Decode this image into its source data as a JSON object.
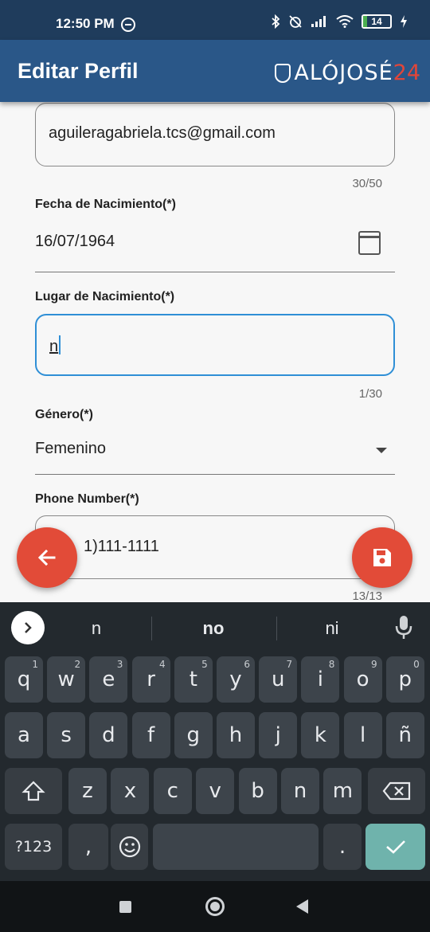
{
  "status_bar": {
    "time": "12:50 PM",
    "battery": "14",
    "icons": [
      "bluetooth-icon",
      "mute-alarm-icon",
      "signal-icon",
      "wifi-icon",
      "battery-icon",
      "charging-icon"
    ]
  },
  "app_bar": {
    "title": "Editar Perfil",
    "brand_name": "ALÓJOSÉ",
    "brand_number": "24"
  },
  "form": {
    "email": {
      "value": "aguileragabriela.tcs@gmail.com",
      "counter": "30/50"
    },
    "birth_date": {
      "label": "Fecha de Nacimiento(*)",
      "value": "16/07/1964"
    },
    "birth_place": {
      "label": "Lugar de Nacimiento(*)",
      "value": "n",
      "counter": "1/30"
    },
    "gender": {
      "label": "Género(*)",
      "value": "Femenino"
    },
    "phone": {
      "label": "Phone Number(*)",
      "value": "(111)111-1111",
      "visible_value": "1)111-1111",
      "counter": "13/13"
    }
  },
  "keyboard": {
    "suggestions": [
      "n",
      "no",
      "ni"
    ],
    "row1": [
      {
        "k": "q",
        "h": "1"
      },
      {
        "k": "w",
        "h": "2"
      },
      {
        "k": "e",
        "h": "3"
      },
      {
        "k": "r",
        "h": "4"
      },
      {
        "k": "t",
        "h": "5"
      },
      {
        "k": "y",
        "h": "6"
      },
      {
        "k": "u",
        "h": "7"
      },
      {
        "k": "i",
        "h": "8"
      },
      {
        "k": "o",
        "h": "9"
      },
      {
        "k": "p",
        "h": "0"
      }
    ],
    "row2": [
      "a",
      "s",
      "d",
      "f",
      "g",
      "h",
      "j",
      "k",
      "l",
      "ñ"
    ],
    "row3": [
      "z",
      "x",
      "c",
      "v",
      "b",
      "n",
      "m"
    ],
    "symbols_label": "?123",
    "comma": ",",
    "period": "."
  },
  "colors": {
    "status_bar": "#1f3c5c",
    "app_bar": "#2a5788",
    "fab": "#e24b38",
    "focus": "#2f8fd6",
    "keyboard_bg": "#23292e",
    "enter_key": "#6fb3ac"
  }
}
